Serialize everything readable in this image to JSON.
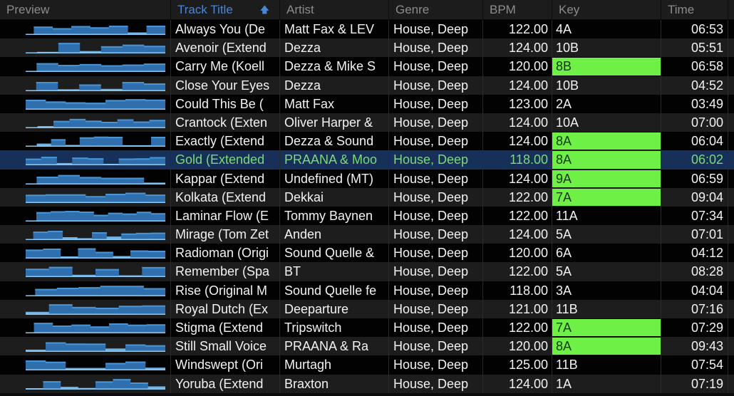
{
  "columns": {
    "preview": "Preview",
    "title": "Track Title",
    "artist": "Artist",
    "genre": "Genre",
    "bpm": "BPM",
    "key": "Key",
    "time": "Time"
  },
  "sort": {
    "column": "title",
    "direction": "ascending",
    "icon": "arrow-up-icon"
  },
  "colors": {
    "key_highlight": "#6ef046",
    "selected_row": "#16305a",
    "selected_text": "#7fd87a",
    "sorted_header": "#4a86d6"
  },
  "tracks": [
    {
      "title": "Always You (De",
      "artist": "Matt Fax & LEV",
      "genre": "House, Deep",
      "bpm": "122.00",
      "key": "4A",
      "key_highlight": false,
      "time": "06:53"
    },
    {
      "title": "Avenoir (Extend",
      "artist": "Dezza",
      "genre": "House, Deep",
      "bpm": "124.00",
      "key": "10B",
      "key_highlight": false,
      "time": "05:51"
    },
    {
      "title": "Carry Me (Koell",
      "artist": "Dezza & Mike S",
      "genre": "House, Deep",
      "bpm": "120.00",
      "key": "8B",
      "key_highlight": true,
      "time": "06:58"
    },
    {
      "title": "Close Your Eyes",
      "artist": "Dezza",
      "genre": "House, Deep",
      "bpm": "124.00",
      "key": "10B",
      "key_highlight": false,
      "time": "04:52"
    },
    {
      "title": "Could This Be (",
      "artist": "Matt Fax",
      "genre": "House, Deep",
      "bpm": "123.00",
      "key": "2A",
      "key_highlight": false,
      "time": "03:49"
    },
    {
      "title": "Crantock (Exten",
      "artist": "Oliver Harper &",
      "genre": "House, Deep",
      "bpm": "124.00",
      "key": "10A",
      "key_highlight": false,
      "time": "07:00"
    },
    {
      "title": "Exactly (Extend",
      "artist": "Dezza & Sound",
      "genre": "House, Deep",
      "bpm": "124.00",
      "key": "8A",
      "key_highlight": true,
      "time": "06:04"
    },
    {
      "title": "Gold (Extended",
      "artist": "PRAANA & Moo",
      "genre": "House, Deep",
      "bpm": "118.00",
      "key": "8A",
      "key_highlight": true,
      "time": "06:02",
      "selected": true
    },
    {
      "title": "Kappar (Extend",
      "artist": "Undefined (MT)",
      "genre": "House, Deep",
      "bpm": "124.00",
      "key": "9A",
      "key_highlight": true,
      "time": "06:59"
    },
    {
      "title": "Kolkata (Extend",
      "artist": "Dekkai",
      "genre": "House, Deep",
      "bpm": "122.00",
      "key": "7A",
      "key_highlight": true,
      "time": "09:04"
    },
    {
      "title": "Laminar Flow (E",
      "artist": "Tommy Baynen",
      "genre": "House, Deep",
      "bpm": "122.00",
      "key": "11A",
      "key_highlight": false,
      "time": "07:34"
    },
    {
      "title": "Mirage (Tom Zet",
      "artist": "Anden",
      "genre": "House, Deep",
      "bpm": "124.00",
      "key": "5A",
      "key_highlight": false,
      "time": "07:01"
    },
    {
      "title": "Radioman (Origi",
      "artist": "Sound Quelle &",
      "genre": "House, Deep",
      "bpm": "120.00",
      "key": "6A",
      "key_highlight": false,
      "time": "04:12"
    },
    {
      "title": "Remember (Spa",
      "artist": "BT",
      "genre": "House, Deep",
      "bpm": "122.00",
      "key": "5A",
      "key_highlight": false,
      "time": "08:28"
    },
    {
      "title": "Rise (Original M",
      "artist": "Sound Quelle fe",
      "genre": "House, Deep",
      "bpm": "118.00",
      "key": "3A",
      "key_highlight": false,
      "time": "04:04"
    },
    {
      "title": "Royal Dutch (Ex",
      "artist": "Deeparture",
      "genre": "House, Deep",
      "bpm": "121.00",
      "key": "11B",
      "key_highlight": false,
      "time": "07:16"
    },
    {
      "title": "Stigma (Extend",
      "artist": "Tripswitch",
      "genre": "House, Deep",
      "bpm": "122.00",
      "key": "7A",
      "key_highlight": true,
      "time": "07:29"
    },
    {
      "title": "Still Small Voice",
      "artist": "PRAANA & Ra",
      "genre": "House, Deep",
      "bpm": "120.00",
      "key": "8A",
      "key_highlight": true,
      "time": "09:43"
    },
    {
      "title": "Windswept (Ori",
      "artist": "Murtagh",
      "genre": "House, Deep",
      "bpm": "125.00",
      "key": "11B",
      "key_highlight": false,
      "time": "07:54"
    },
    {
      "title": "Yoruba (Extend",
      "artist": "Braxton",
      "genre": "House, Deep",
      "bpm": "124.00",
      "key": "1A",
      "key_highlight": false,
      "time": "07:19"
    }
  ]
}
